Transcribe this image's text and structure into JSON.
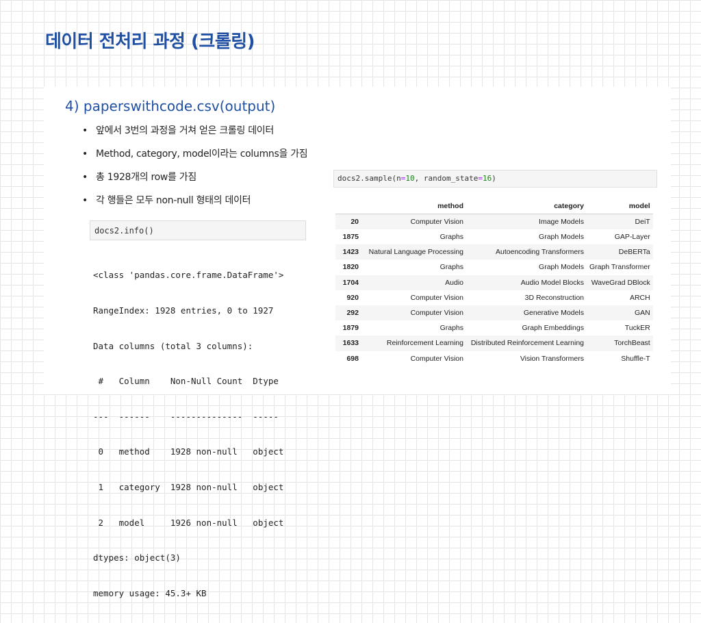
{
  "slide": {
    "title": "데이터 전처리 과정 (크롤링)",
    "section_title": "4) paperswithcode.csv(output)",
    "bullets": [
      "앞에서 3번의 과정을 거쳐 얻은 크롤링 데이터",
      "Method, category, model이라는 columns을 가짐",
      "총 1928개의 row를 가짐",
      "각 행들은 모두 non-null 형태의 데이터"
    ]
  },
  "info_cell": {
    "input": "docs2.info()",
    "output": [
      "<class 'pandas.core.frame.DataFrame'>",
      "RangeIndex: 1928 entries, 0 to 1927",
      "Data columns (total 3 columns):",
      " #   Column    Non-Null Count  Dtype ",
      "---  ------    --------------  ----- ",
      " 0   method    1928 non-null   object",
      " 1   category  1928 non-null   object",
      " 2   model     1926 non-null   object",
      "dtypes: object(3)",
      "memory usage: 45.3+ KB"
    ]
  },
  "sample_cell": {
    "code_prefix": "docs2.sample(",
    "arg1_name": "n",
    "eq": "=",
    "arg1_value": "10",
    "sep": ", ",
    "arg2_name": "random_state",
    "arg2_value": "16",
    "code_suffix": ")"
  },
  "table": {
    "columns": [
      "",
      "method",
      "category",
      "model"
    ],
    "rows": [
      {
        "index": "20",
        "method": "Computer Vision",
        "category": "Image Models",
        "model": "DeiT"
      },
      {
        "index": "1875",
        "method": "Graphs",
        "category": "Graph Models",
        "model": "GAP-Layer"
      },
      {
        "index": "1423",
        "method": "Natural Language Processing",
        "category": "Autoencoding Transformers",
        "model": "DeBERTa"
      },
      {
        "index": "1820",
        "method": "Graphs",
        "category": "Graph Models",
        "model": "Graph Transformer"
      },
      {
        "index": "1704",
        "method": "Audio",
        "category": "Audio Model Blocks",
        "model": "WaveGrad DBlock"
      },
      {
        "index": "920",
        "method": "Computer Vision",
        "category": "3D Reconstruction",
        "model": "ARCH"
      },
      {
        "index": "292",
        "method": "Computer Vision",
        "category": "Generative Models",
        "model": "GAN"
      },
      {
        "index": "1879",
        "method": "Graphs",
        "category": "Graph Embeddings",
        "model": "TuckER"
      },
      {
        "index": "1633",
        "method": "Reinforcement Learning",
        "category": "Distributed Reinforcement Learning",
        "model": "TorchBeast"
      },
      {
        "index": "698",
        "method": "Computer Vision",
        "category": "Vision Transformers",
        "model": "Shuffle-T"
      }
    ]
  }
}
